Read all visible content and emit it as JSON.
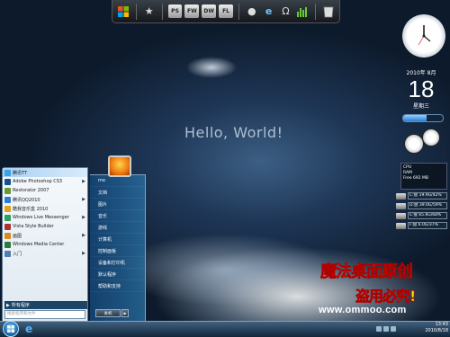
{
  "hello": "Hello, World!",
  "dock": {
    "badges": [
      "PS",
      "FW",
      "DW",
      "FL"
    ]
  },
  "date_gadget": {
    "year_month": "2010年 8月",
    "day": "18",
    "weekday": "星期三"
  },
  "progress": {
    "value_percent": 60
  },
  "sys_stats": {
    "cpu_label": "CPU",
    "ram_label": "RAM",
    "free_label": "Free",
    "free_value": "692 MB"
  },
  "drives": [
    {
      "text": "C:盘 19.9G/42%"
    },
    {
      "text": "D:盘 39.0G/59%"
    },
    {
      "text": "E:盘 65.6G/68%"
    },
    {
      "text": "F:盘 6.0G/37%"
    }
  ],
  "start_menu": {
    "programs": [
      {
        "label": "腾讯TT",
        "color": "#3ba0e6",
        "arrow": false,
        "highlight": true
      },
      {
        "label": "Adobe Photoshop CS3",
        "color": "#1a4f8f",
        "arrow": true,
        "highlight": false
      },
      {
        "label": "Restorator 2007",
        "color": "#6a9a2a",
        "arrow": false,
        "highlight": false
      },
      {
        "label": "腾讯QQ2010",
        "color": "#2c7bd6",
        "arrow": true,
        "highlight": false
      },
      {
        "label": "酷我音乐盒 2010",
        "color": "#e0a020",
        "arrow": false,
        "highlight": false
      },
      {
        "label": "Windows Live Messenger",
        "color": "#2aa25a",
        "arrow": true,
        "highlight": false
      },
      {
        "label": "Vista Style Builder",
        "color": "#b03030",
        "arrow": false,
        "highlight": false
      },
      {
        "label": "画图",
        "color": "#d88a20",
        "arrow": true,
        "highlight": false
      },
      {
        "label": "Windows Media Center",
        "color": "#2d7a3a",
        "arrow": false,
        "highlight": false
      },
      {
        "label": "入门",
        "color": "#4f7fb0",
        "arrow": true,
        "highlight": false
      }
    ],
    "all_programs": "所有程序",
    "search_placeholder": "搜索程序和文件",
    "right_items": [
      "mo",
      "文档",
      "图片",
      "音乐",
      "游戏",
      "计算机",
      "控制面板",
      "设备和打印机",
      "默认程序",
      "帮助和支持"
    ],
    "shutdown": "关机"
  },
  "watermark": {
    "line1": "魔法桌面原创",
    "line2": "盗用必究!",
    "url": "www.ommoo.com"
  },
  "taskbar": {
    "time": "13:43",
    "date": "2010/8/18"
  }
}
